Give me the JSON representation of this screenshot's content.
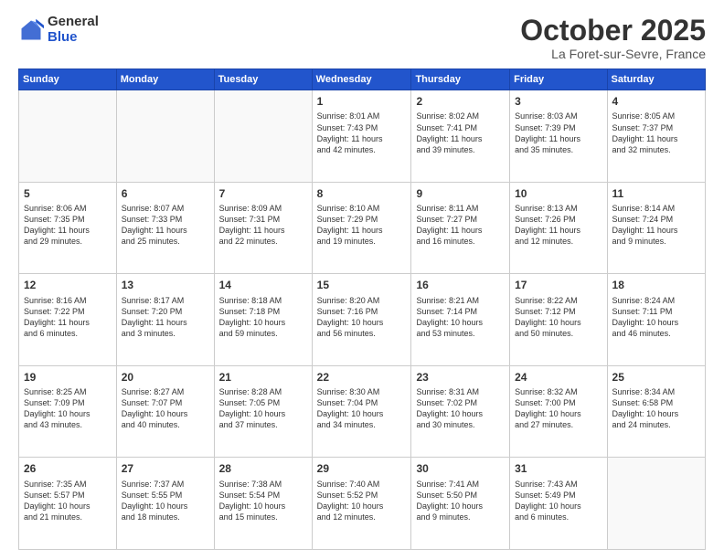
{
  "header": {
    "logo_general": "General",
    "logo_blue": "Blue",
    "month_title": "October 2025",
    "location": "La Foret-sur-Sevre, France"
  },
  "days_of_week": [
    "Sunday",
    "Monday",
    "Tuesday",
    "Wednesday",
    "Thursday",
    "Friday",
    "Saturday"
  ],
  "weeks": [
    [
      {
        "day": "",
        "info": ""
      },
      {
        "day": "",
        "info": ""
      },
      {
        "day": "",
        "info": ""
      },
      {
        "day": "1",
        "info": "Sunrise: 8:01 AM\nSunset: 7:43 PM\nDaylight: 11 hours\nand 42 minutes."
      },
      {
        "day": "2",
        "info": "Sunrise: 8:02 AM\nSunset: 7:41 PM\nDaylight: 11 hours\nand 39 minutes."
      },
      {
        "day": "3",
        "info": "Sunrise: 8:03 AM\nSunset: 7:39 PM\nDaylight: 11 hours\nand 35 minutes."
      },
      {
        "day": "4",
        "info": "Sunrise: 8:05 AM\nSunset: 7:37 PM\nDaylight: 11 hours\nand 32 minutes."
      }
    ],
    [
      {
        "day": "5",
        "info": "Sunrise: 8:06 AM\nSunset: 7:35 PM\nDaylight: 11 hours\nand 29 minutes."
      },
      {
        "day": "6",
        "info": "Sunrise: 8:07 AM\nSunset: 7:33 PM\nDaylight: 11 hours\nand 25 minutes."
      },
      {
        "day": "7",
        "info": "Sunrise: 8:09 AM\nSunset: 7:31 PM\nDaylight: 11 hours\nand 22 minutes."
      },
      {
        "day": "8",
        "info": "Sunrise: 8:10 AM\nSunset: 7:29 PM\nDaylight: 11 hours\nand 19 minutes."
      },
      {
        "day": "9",
        "info": "Sunrise: 8:11 AM\nSunset: 7:27 PM\nDaylight: 11 hours\nand 16 minutes."
      },
      {
        "day": "10",
        "info": "Sunrise: 8:13 AM\nSunset: 7:26 PM\nDaylight: 11 hours\nand 12 minutes."
      },
      {
        "day": "11",
        "info": "Sunrise: 8:14 AM\nSunset: 7:24 PM\nDaylight: 11 hours\nand 9 minutes."
      }
    ],
    [
      {
        "day": "12",
        "info": "Sunrise: 8:16 AM\nSunset: 7:22 PM\nDaylight: 11 hours\nand 6 minutes."
      },
      {
        "day": "13",
        "info": "Sunrise: 8:17 AM\nSunset: 7:20 PM\nDaylight: 11 hours\nand 3 minutes."
      },
      {
        "day": "14",
        "info": "Sunrise: 8:18 AM\nSunset: 7:18 PM\nDaylight: 10 hours\nand 59 minutes."
      },
      {
        "day": "15",
        "info": "Sunrise: 8:20 AM\nSunset: 7:16 PM\nDaylight: 10 hours\nand 56 minutes."
      },
      {
        "day": "16",
        "info": "Sunrise: 8:21 AM\nSunset: 7:14 PM\nDaylight: 10 hours\nand 53 minutes."
      },
      {
        "day": "17",
        "info": "Sunrise: 8:22 AM\nSunset: 7:12 PM\nDaylight: 10 hours\nand 50 minutes."
      },
      {
        "day": "18",
        "info": "Sunrise: 8:24 AM\nSunset: 7:11 PM\nDaylight: 10 hours\nand 46 minutes."
      }
    ],
    [
      {
        "day": "19",
        "info": "Sunrise: 8:25 AM\nSunset: 7:09 PM\nDaylight: 10 hours\nand 43 minutes."
      },
      {
        "day": "20",
        "info": "Sunrise: 8:27 AM\nSunset: 7:07 PM\nDaylight: 10 hours\nand 40 minutes."
      },
      {
        "day": "21",
        "info": "Sunrise: 8:28 AM\nSunset: 7:05 PM\nDaylight: 10 hours\nand 37 minutes."
      },
      {
        "day": "22",
        "info": "Sunrise: 8:30 AM\nSunset: 7:04 PM\nDaylight: 10 hours\nand 34 minutes."
      },
      {
        "day": "23",
        "info": "Sunrise: 8:31 AM\nSunset: 7:02 PM\nDaylight: 10 hours\nand 30 minutes."
      },
      {
        "day": "24",
        "info": "Sunrise: 8:32 AM\nSunset: 7:00 PM\nDaylight: 10 hours\nand 27 minutes."
      },
      {
        "day": "25",
        "info": "Sunrise: 8:34 AM\nSunset: 6:58 PM\nDaylight: 10 hours\nand 24 minutes."
      }
    ],
    [
      {
        "day": "26",
        "info": "Sunrise: 7:35 AM\nSunset: 5:57 PM\nDaylight: 10 hours\nand 21 minutes."
      },
      {
        "day": "27",
        "info": "Sunrise: 7:37 AM\nSunset: 5:55 PM\nDaylight: 10 hours\nand 18 minutes."
      },
      {
        "day": "28",
        "info": "Sunrise: 7:38 AM\nSunset: 5:54 PM\nDaylight: 10 hours\nand 15 minutes."
      },
      {
        "day": "29",
        "info": "Sunrise: 7:40 AM\nSunset: 5:52 PM\nDaylight: 10 hours\nand 12 minutes."
      },
      {
        "day": "30",
        "info": "Sunrise: 7:41 AM\nSunset: 5:50 PM\nDaylight: 10 hours\nand 9 minutes."
      },
      {
        "day": "31",
        "info": "Sunrise: 7:43 AM\nSunset: 5:49 PM\nDaylight: 10 hours\nand 6 minutes."
      },
      {
        "day": "",
        "info": ""
      }
    ]
  ]
}
